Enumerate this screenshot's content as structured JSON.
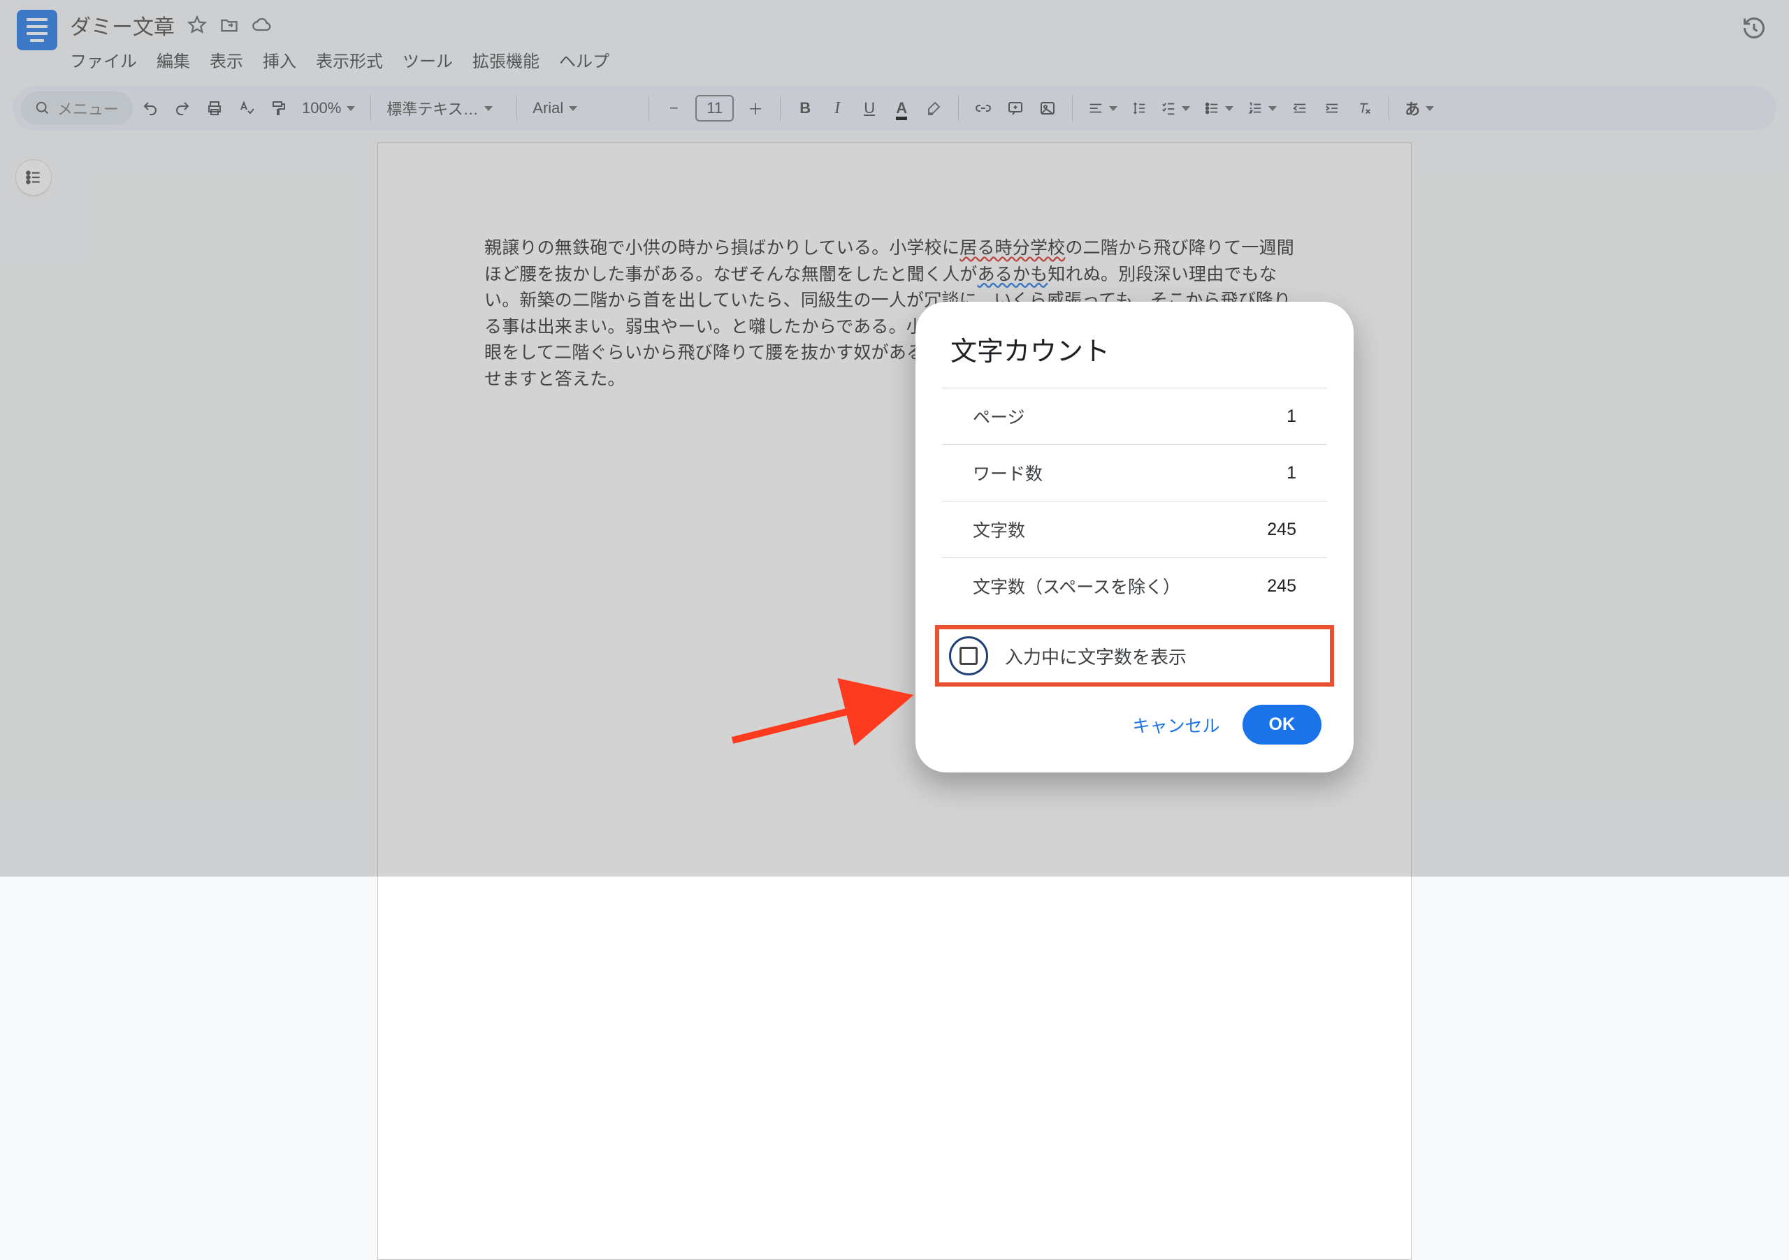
{
  "header": {
    "doc_title": "ダミー文章",
    "icons": {
      "star": "star-icon",
      "move": "move-to-folder-icon",
      "cloud": "cloud-saved-icon",
      "history": "history-icon",
      "logo": "docs-logo"
    }
  },
  "menu": {
    "file": "ファイル",
    "edit": "編集",
    "view": "表示",
    "insert": "挿入",
    "format": "表示形式",
    "tools": "ツール",
    "extensions": "拡張機能",
    "help": "ヘルプ"
  },
  "toolbar": {
    "search_label": "メニュー",
    "zoom": "100%",
    "style": "標準テキス…",
    "font": "Arial",
    "font_size": "11",
    "input_mode": "あ",
    "icons": {
      "search": "search-icon",
      "undo": "undo-icon",
      "redo": "redo-icon",
      "print": "print-icon",
      "spellcheck": "spellcheck-icon",
      "paint": "paint-format-icon",
      "minus": "decrease-font-icon",
      "plus": "increase-font-icon",
      "bold": "bold-icon",
      "italic": "italic-icon",
      "underline": "underline-icon",
      "textcolor": "text-color-icon",
      "highlight": "highlight-icon",
      "link": "insert-link-icon",
      "comment": "add-comment-icon",
      "image": "insert-image-icon",
      "align": "align-icon",
      "linespace": "line-spacing-icon",
      "checklist": "checklist-icon",
      "bullets": "bulleted-list-icon",
      "numbers": "numbered-list-icon",
      "indent_dec": "decrease-indent-icon",
      "indent_inc": "increase-indent-icon",
      "clear": "clear-formatting-icon"
    }
  },
  "outline": {
    "icon": "document-outline-icon"
  },
  "document": {
    "body": "親譲りの無鉄砲で小供の時から損ばかりしている。小学校に居る時分学校の二階から飛び降りて一週間ほど腰を抜かした事がある。なぜそんな無闇をしたと聞く人があるかも知れぬ。別段深い理由でもない。新築の二階から首を出していたら、同級生の一人が冗談に、いくら威張っても、そこから飛び降りる事は出来まい。弱虫やーい。と囃したからである。小使に負ぶさって帰って来た時、おやじが大きな眼をして二階ぐらいから飛び降りて腰を抜かす奴があるかと云ったから、この次は抜かさずに飛んで見せますと答えた。",
    "spell_seg1": "居る時分学校",
    "spell_seg2": "あるかも"
  },
  "dialog": {
    "title": "文字カウント",
    "rows": {
      "pages_label": "ページ",
      "pages_value": "1",
      "words_label": "ワード数",
      "words_value": "1",
      "chars_label": "文字数",
      "chars_value": "245",
      "chars_nospace_label": "文字数（スペースを除く）",
      "chars_nospace_value": "245"
    },
    "show_while_typing_label": "入力中に文字数を表示",
    "cancel": "キャンセル",
    "ok": "OK"
  },
  "colors": {
    "accent": "#1a73e8",
    "highlight_box": "#e8512f"
  }
}
